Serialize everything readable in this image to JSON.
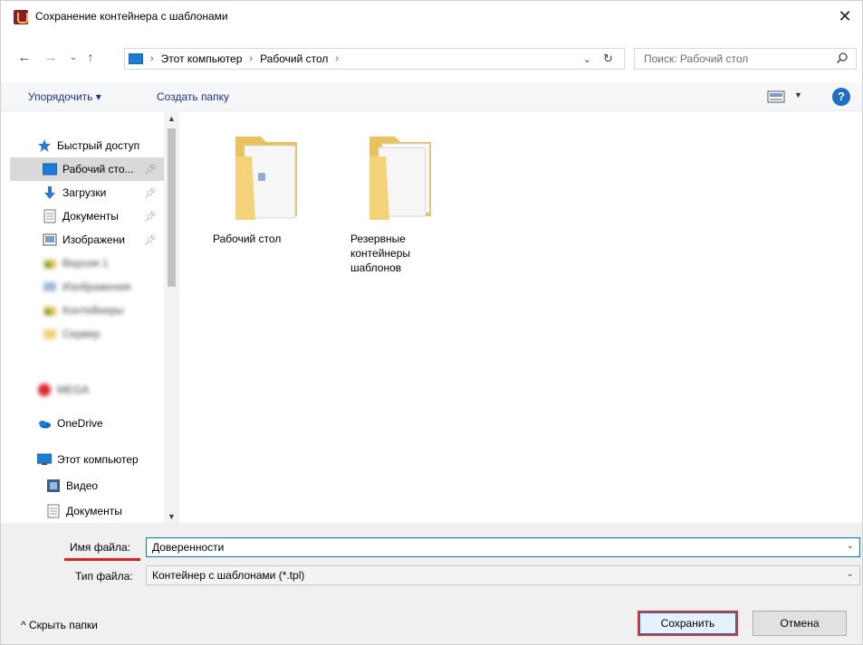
{
  "window": {
    "title": "Сохранение контейнера с шаблонами",
    "close_glyph": "✕"
  },
  "address": {
    "breadcrumbs": [
      "Этот компьютер",
      "Рабочий стол"
    ],
    "separator": "›",
    "search_placeholder": "Поиск: Рабочий стол"
  },
  "toolbar": {
    "organize_label": "Упорядочить ▾",
    "new_folder_label": "Создать папку",
    "help_glyph": "?"
  },
  "navpane": {
    "items": [
      {
        "label": "Быстрый доступ",
        "icon": "star-icon"
      },
      {
        "label": "Рабочий сто...",
        "icon": "desktop-icon",
        "pinned": true,
        "selected": true
      },
      {
        "label": "Загрузки",
        "icon": "download-icon",
        "pinned": true
      },
      {
        "label": "Документы",
        "icon": "documents-icon",
        "pinned": true
      },
      {
        "label": "Изображени",
        "icon": "pictures-icon",
        "pinned": true
      },
      {
        "label": "Версия 1",
        "icon": "folder-icon",
        "blurred": true
      },
      {
        "label": "Изображения",
        "icon": "pictures-icon",
        "blurred": true
      },
      {
        "label": "Контейнеры",
        "icon": "folder-icon",
        "blurred": true
      },
      {
        "label": "Сервер",
        "icon": "folder-icon",
        "blurred": true
      },
      {
        "label": "MEGA",
        "icon": "mega-icon",
        "blurred": true
      },
      {
        "label": "OneDrive",
        "icon": "onedrive-icon"
      },
      {
        "label": "Этот компьютер",
        "icon": "computer-icon"
      },
      {
        "label": "Видео",
        "icon": "video-icon"
      },
      {
        "label": "Документы",
        "icon": "documents-icon"
      }
    ]
  },
  "files": [
    {
      "label": "Рабочий стол",
      "icon": "folder-icon"
    },
    {
      "label": "Резервные контейнеры шаблонов",
      "icon": "folder-icon"
    }
  ],
  "form": {
    "filename_label": "Имя файла:",
    "filename_value": "Доверенности",
    "filetype_label": "Тип файла:",
    "filetype_value": "Контейнер с шаблонами (*.tpl)"
  },
  "footer": {
    "hide_folders_label": "^ Скрыть папки",
    "save_label": "Сохранить",
    "cancel_label": "Отмена"
  }
}
